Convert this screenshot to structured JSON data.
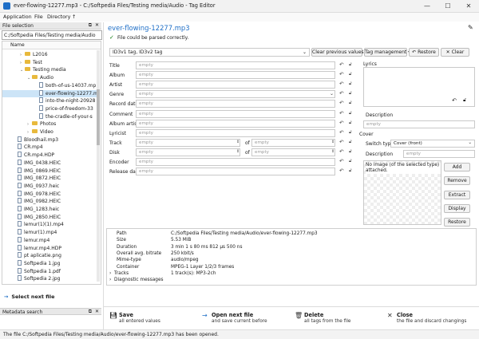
{
  "window": {
    "title": "ever-flowing-12277.mp3 - C:/Softpedia Files/Testing media/Audio - Tag Editor",
    "minimize": "—",
    "maximize": "☐",
    "close": "✕"
  },
  "menu": [
    "Application",
    "File",
    "Directory",
    "↑"
  ],
  "file_selection": {
    "header": "File selection",
    "path": "C:/Softpedia Files/Testing media/Audio",
    "column": "Name",
    "items": [
      {
        "label": "L2016",
        "depth": 2,
        "kind": "folder",
        "expander": "›"
      },
      {
        "label": "Test",
        "depth": 2,
        "kind": "folder",
        "expander": "›"
      },
      {
        "label": "Testing media",
        "depth": 2,
        "kind": "folder",
        "expander": "⌄"
      },
      {
        "label": "Audio",
        "depth": 3,
        "kind": "folder",
        "expander": "⌄"
      },
      {
        "label": "both-of-us-14037.mp",
        "depth": 4,
        "kind": "file"
      },
      {
        "label": "ever-flowing-12277.m",
        "depth": 4,
        "kind": "file",
        "selected": true
      },
      {
        "label": "into-the-night-20928",
        "depth": 4,
        "kind": "file"
      },
      {
        "label": "price-of-freedom-33",
        "depth": 4,
        "kind": "file"
      },
      {
        "label": "the-cradle-of-your-s",
        "depth": 4,
        "kind": "file"
      },
      {
        "label": "Photos",
        "depth": 3,
        "kind": "folder",
        "expander": "›"
      },
      {
        "label": "Video",
        "depth": 3,
        "kind": "folder",
        "expander": "›"
      },
      {
        "label": "Bloodhail.mp3",
        "depth": 1,
        "kind": "file"
      },
      {
        "label": "CR.mp4",
        "depth": 1,
        "kind": "file"
      },
      {
        "label": "CR.mp4.HDP",
        "depth": 1,
        "kind": "file"
      },
      {
        "label": "IMG_0438.HEIC",
        "depth": 1,
        "kind": "file"
      },
      {
        "label": "IMG_0869.HEIC",
        "depth": 1,
        "kind": "file"
      },
      {
        "label": "IMG_0872.HEIC",
        "depth": 1,
        "kind": "file"
      },
      {
        "label": "IMG_0937.heic",
        "depth": 1,
        "kind": "file"
      },
      {
        "label": "IMG_0978.HEIC",
        "depth": 1,
        "kind": "file"
      },
      {
        "label": "IMG_0982.HEIC",
        "depth": 1,
        "kind": "file"
      },
      {
        "label": "IMG_1283.heic",
        "depth": 1,
        "kind": "file"
      },
      {
        "label": "IMG_2850.HEIC",
        "depth": 1,
        "kind": "file"
      },
      {
        "label": "lemur(1)(1).mp4",
        "depth": 1,
        "kind": "file"
      },
      {
        "label": "lemur(1).mp4",
        "depth": 1,
        "kind": "file"
      },
      {
        "label": "lemur.mp4",
        "depth": 1,
        "kind": "file"
      },
      {
        "label": "lemur.mp4.HDP",
        "depth": 1,
        "kind": "file"
      },
      {
        "label": "pt aplicatie.png",
        "depth": 1,
        "kind": "file"
      },
      {
        "label": "Softpedia 1.jpg",
        "depth": 1,
        "kind": "file"
      },
      {
        "label": "Softpedia 1.pdf",
        "depth": 1,
        "kind": "file"
      },
      {
        "label": "Softpedia 2.jpg",
        "depth": 1,
        "kind": "file"
      }
    ],
    "select_next": "Select next file"
  },
  "metadata_search": {
    "header": "Metadata search"
  },
  "editor": {
    "heading": "ever-flowing-12277.mp3",
    "parse_status": "File could be parsed correctly.",
    "tag_select": "ID3v1 tag, ID3v2 tag",
    "clear_previous": "Clear previous values ▾",
    "tag_management": "Tag management ▾",
    "restore": "Restore",
    "clear": "Clear",
    "placeholder": "empty",
    "fields": [
      "Title",
      "Album",
      "Artist",
      "Genre",
      "Record date",
      "Comment",
      "Album artist",
      "Lyricist",
      "Track",
      "Disk",
      "Encoder",
      "Release date"
    ],
    "of_label": "of",
    "lyrics_label": "Lyrics",
    "description_label": "Description",
    "cover_label": "Cover",
    "switch_type_label": "Switch type",
    "switch_type_value": "Cover (front)",
    "cover_note": "No image (of the selected type) attached.",
    "cover_buttons": [
      "Add",
      "Remove",
      "Extract",
      "Display",
      "Restore"
    ]
  },
  "file_info": [
    {
      "key": "Path",
      "value": "C:/Softpedia Files/Testing media/Audio/ever-flowing-12277.mp3"
    },
    {
      "key": "Size",
      "value": "5.53 MiB"
    },
    {
      "key": "Duration",
      "value": "3 min 1 s 80 ms 812 µs 500 ns"
    },
    {
      "key": "Overall avg. bitrate",
      "value": "250 kbit/s"
    },
    {
      "key": "Mime-type",
      "value": "audio/mpeg"
    },
    {
      "key": "Container",
      "value": "MPEG-1 Layer 1/2/3 frames"
    },
    {
      "key": "Tracks",
      "value": "1 track(s): MP3-2ch",
      "expander": "›"
    },
    {
      "key": "Diagnostic messages",
      "value": "",
      "expander": "›"
    }
  ],
  "footer": [
    {
      "title": "Save",
      "sub": "all entered values"
    },
    {
      "title": "Open next file",
      "sub": "and save current before"
    },
    {
      "title": "Delete",
      "sub": "all tags from the file"
    },
    {
      "title": "Close",
      "sub": "the file and discard changings"
    }
  ],
  "status": "The file C:/Softpedia Files/Testing media/Audio/ever-flowing-12277.mp3 has been opened.",
  "colors": {
    "accent": "#1f6fc7",
    "selection": "#cce4f7",
    "folder": "#e8b93c"
  }
}
